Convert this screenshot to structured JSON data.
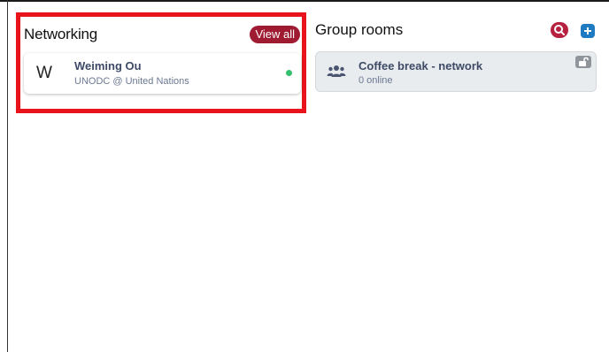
{
  "networking": {
    "title": "Networking",
    "view_all_label": "View all",
    "people": [
      {
        "avatar_initial": "W",
        "name": "Weiming Ou",
        "organization": "UNODC @ United Nations",
        "status": "online",
        "status_color": "#35c06f"
      }
    ]
  },
  "group_rooms": {
    "title": "Group rooms",
    "search_icon": "search-icon",
    "add_icon": "plus-icon",
    "rooms": [
      {
        "icon": "users-icon",
        "name": "Coffee break - network",
        "online_count": "0 online",
        "badge_icon": "unlock-icon"
      }
    ]
  },
  "colors": {
    "highlight_border": "#e8131b",
    "view_all_bg": "#9e1b32",
    "search_bg": "#b5213e",
    "add_bg": "#1f7bc1",
    "name_text": "#3e4a66",
    "room_card_bg": "#e9ecef"
  }
}
